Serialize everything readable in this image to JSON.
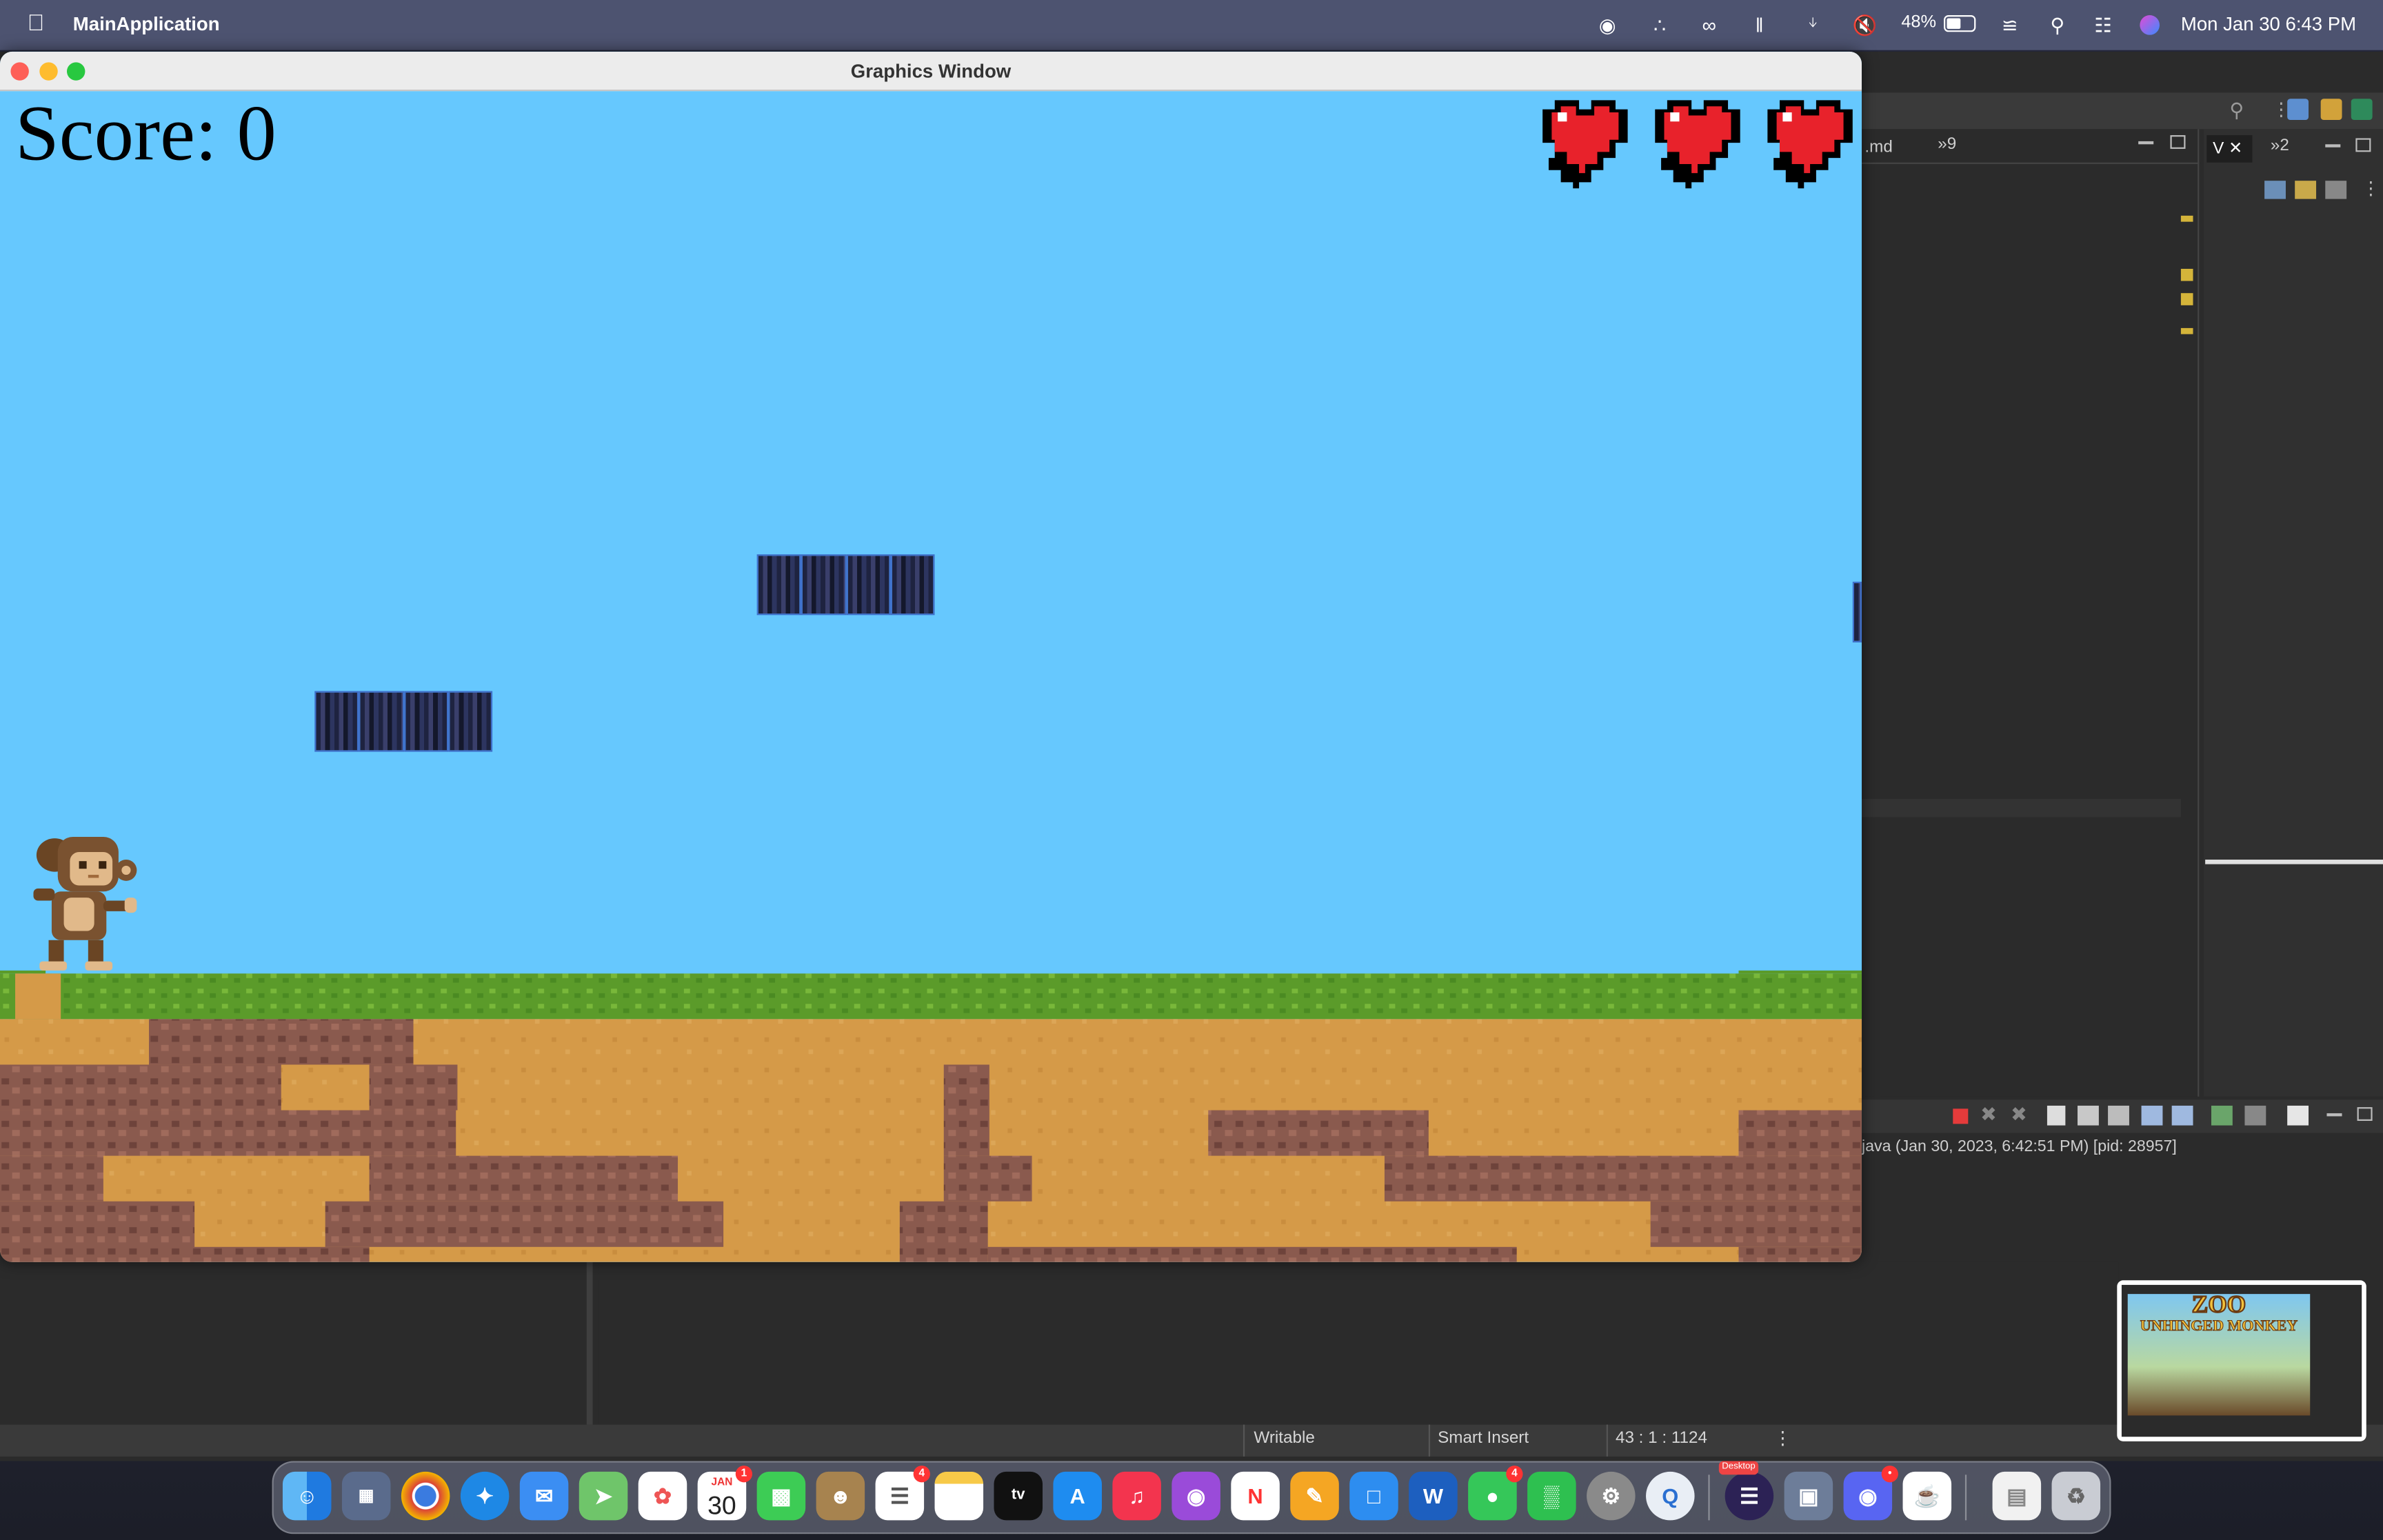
{
  "menubar": {
    "app_name": "MainApplication",
    "battery": "48%",
    "clock": "Mon Jan 30  6:43 PM"
  },
  "window": {
    "title": "Graphics Window"
  },
  "game": {
    "score_text": "Score: 0",
    "lives": 3
  },
  "ide": {
    "tab_md": ".md",
    "tab_overflow_1": "»9",
    "tab_overflow_2": "»2",
    "view_tab": "V",
    "console_text": "java  (Jan 30, 2023, 6:42:51 PM) [pid: 28957]"
  },
  "statusbar": {
    "writable": "Writable",
    "insert_mode": "Smart Insert",
    "position": "43 : 1 : 1124"
  },
  "dock": {
    "calendar_month": "JAN",
    "calendar_day": "30",
    "calendar_badge": "1",
    "reminders_badge": "4",
    "messages_badge": "4",
    "desktop_label": "Desktop",
    "discord_badge": "•"
  },
  "thumbnail": {
    "title_line1": "ZOO",
    "title_line2": "UNHINGED MONKEY"
  },
  "colors": {
    "sky": "#66c8fe",
    "grass": "#5b9b2a",
    "dirt": "#d59a48",
    "rock": "#8a5a4e",
    "heart": "#e8222b"
  }
}
